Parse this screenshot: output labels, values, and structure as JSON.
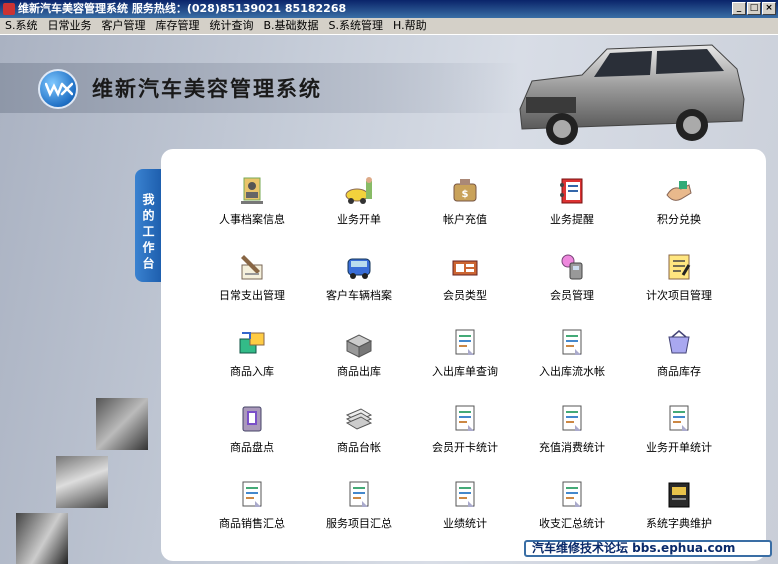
{
  "window": {
    "title": "维新汽车美容管理系统 服务热线：(028)85139021  85182268"
  },
  "menu": [
    {
      "label": "S.系统",
      "name": "menu-system"
    },
    {
      "label": "日常业务",
      "name": "menu-daily-business"
    },
    {
      "label": "客户管理",
      "name": "menu-customer"
    },
    {
      "label": "库存管理",
      "name": "menu-inventory"
    },
    {
      "label": "统计查询",
      "name": "menu-statistics"
    },
    {
      "label": "B.基础数据",
      "name": "menu-base-data"
    },
    {
      "label": "S.系统管理",
      "name": "menu-system-admin"
    },
    {
      "label": "H.帮助",
      "name": "menu-help"
    }
  ],
  "header": {
    "system_title": "维新汽车美容管理系统"
  },
  "side_tab": {
    "label": "我的工作台"
  },
  "tiles": [
    {
      "label": "人事档案信息",
      "icon": "personnel-file-icon"
    },
    {
      "label": "业务开单",
      "icon": "car-order-icon"
    },
    {
      "label": "帐户充值",
      "icon": "money-bag-icon"
    },
    {
      "label": "业务提醒",
      "icon": "reminder-book-icon"
    },
    {
      "label": "积分兑换",
      "icon": "points-exchange-icon"
    },
    {
      "label": "日常支出管理",
      "icon": "expense-pen-icon"
    },
    {
      "label": "客户车辆档案",
      "icon": "vehicle-file-icon"
    },
    {
      "label": "会员类型",
      "icon": "member-type-icon"
    },
    {
      "label": "会员管理",
      "icon": "member-manage-icon"
    },
    {
      "label": "计次项目管理",
      "icon": "count-item-icon"
    },
    {
      "label": "商品入库",
      "icon": "goods-in-icon"
    },
    {
      "label": "商品出库",
      "icon": "goods-out-icon"
    },
    {
      "label": "入出库单查询",
      "icon": "document-icon"
    },
    {
      "label": "入出库流水帐",
      "icon": "document-icon"
    },
    {
      "label": "商品库存",
      "icon": "stock-basket-icon"
    },
    {
      "label": "商品盘点",
      "icon": "inventory-check-icon"
    },
    {
      "label": "商品台帐",
      "icon": "ledger-stack-icon"
    },
    {
      "label": "会员开卡统计",
      "icon": "document-icon"
    },
    {
      "label": "充值消费统计",
      "icon": "document-icon"
    },
    {
      "label": "业务开单统计",
      "icon": "document-icon"
    },
    {
      "label": "商品销售汇总",
      "icon": "document-icon"
    },
    {
      "label": "服务项目汇总",
      "icon": "document-icon"
    },
    {
      "label": "业绩统计",
      "icon": "document-icon"
    },
    {
      "label": "收支汇总统计",
      "icon": "document-icon"
    },
    {
      "label": "系统字典维护",
      "icon": "dictionary-book-icon"
    }
  ],
  "footer": {
    "link_text": "汽车维修技术论坛 bbs.ephua.com"
  },
  "colors": {
    "titlebar": "#0a246a",
    "accent_tab": "#1e5fae",
    "panel": "#ffffff"
  }
}
